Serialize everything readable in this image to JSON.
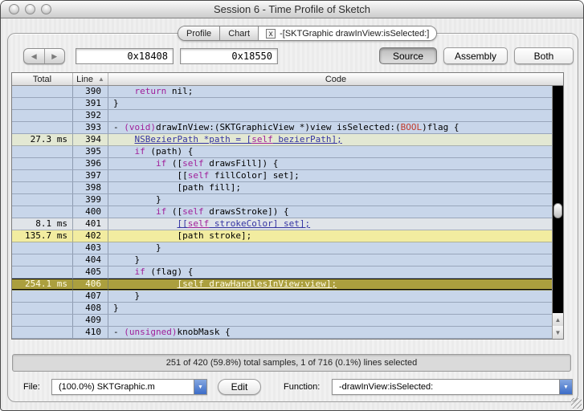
{
  "window": {
    "title": "Session 6 - Time Profile of Sketch"
  },
  "tabs": [
    {
      "label": "Profile"
    },
    {
      "label": "Chart"
    },
    {
      "label": "-[SKTGraphic drawInView:isSelected:]",
      "close": "x",
      "selected": true
    }
  ],
  "toolbar": {
    "back_icon": "◀",
    "forward_icon": "▶",
    "address_start": "0x18408",
    "address_end": "0x18550",
    "view_buttons": [
      {
        "label": "Source",
        "selected": true
      },
      {
        "label": "Assembly",
        "selected": false
      },
      {
        "label": "Both",
        "selected": false
      }
    ]
  },
  "table": {
    "columns": [
      "Total",
      "Line",
      "Code"
    ],
    "sort_column": "Line",
    "sort_direction": "asc",
    "sort_icon": "▲",
    "rows": [
      {
        "total": "",
        "line": "390",
        "bg": "blue",
        "code": [
          {
            "t": "    ",
            "c": "p"
          },
          {
            "t": "return",
            "c": "k"
          },
          {
            "t": " nil;",
            "c": "p"
          }
        ]
      },
      {
        "total": "",
        "line": "391",
        "bg": "blue",
        "code": [
          {
            "t": "}",
            "c": "p"
          }
        ]
      },
      {
        "total": "",
        "line": "392",
        "bg": "blue",
        "code": []
      },
      {
        "total": "",
        "line": "393",
        "bg": "blue",
        "code": [
          {
            "t": "- ",
            "c": "p"
          },
          {
            "t": "(void)",
            "c": "k"
          },
          {
            "t": "drawInView:(SKTGraphicView *)view isSelected:(",
            "c": "p"
          },
          {
            "t": "BOOL",
            "c": "r"
          },
          {
            "t": ")flag {",
            "c": "p"
          }
        ]
      },
      {
        "total": "27.3 ms",
        "line": "394",
        "bg": "green",
        "code": [
          {
            "t": "    ",
            "c": "p"
          },
          {
            "t": "NSBezierPath *path = [",
            "c": "l"
          },
          {
            "t": "self",
            "c": "lk"
          },
          {
            "t": " bezierPath];",
            "c": "l"
          }
        ]
      },
      {
        "total": "",
        "line": "395",
        "bg": "blue",
        "code": [
          {
            "t": "    ",
            "c": "p"
          },
          {
            "t": "if",
            "c": "k"
          },
          {
            "t": " (path) {",
            "c": "p"
          }
        ]
      },
      {
        "total": "",
        "line": "396",
        "bg": "blue",
        "code": [
          {
            "t": "        ",
            "c": "p"
          },
          {
            "t": "if",
            "c": "k"
          },
          {
            "t": " ([",
            "c": "p"
          },
          {
            "t": "self",
            "c": "k"
          },
          {
            "t": " drawsFill]) {",
            "c": "p"
          }
        ]
      },
      {
        "total": "",
        "line": "397",
        "bg": "blue",
        "code": [
          {
            "t": "            [[",
            "c": "p"
          },
          {
            "t": "self",
            "c": "k"
          },
          {
            "t": " fillColor] set];",
            "c": "p"
          }
        ]
      },
      {
        "total": "",
        "line": "398",
        "bg": "blue",
        "code": [
          {
            "t": "            [path fill];",
            "c": "p"
          }
        ]
      },
      {
        "total": "",
        "line": "399",
        "bg": "blue",
        "code": [
          {
            "t": "        }",
            "c": "p"
          }
        ]
      },
      {
        "total": "",
        "line": "400",
        "bg": "blue",
        "code": [
          {
            "t": "        ",
            "c": "p"
          },
          {
            "t": "if",
            "c": "k"
          },
          {
            "t": " ([",
            "c": "p"
          },
          {
            "t": "self",
            "c": "k"
          },
          {
            "t": " drawsStroke]) {",
            "c": "p"
          }
        ]
      },
      {
        "total": "8.1 ms",
        "line": "401",
        "bg": "gray",
        "code": [
          {
            "t": "            ",
            "c": "p"
          },
          {
            "t": "[[",
            "c": "l"
          },
          {
            "t": "self",
            "c": "lk"
          },
          {
            "t": " strokeColor] set];",
            "c": "l"
          }
        ]
      },
      {
        "total": "135.7 ms",
        "line": "402",
        "bg": "yellow",
        "code": [
          {
            "t": "            [path stroke];",
            "c": "p"
          }
        ]
      },
      {
        "total": "",
        "line": "403",
        "bg": "blue",
        "code": [
          {
            "t": "        }",
            "c": "p"
          }
        ]
      },
      {
        "total": "",
        "line": "404",
        "bg": "blue",
        "code": [
          {
            "t": "    }",
            "c": "p"
          }
        ]
      },
      {
        "total": "",
        "line": "405",
        "bg": "blue",
        "code": [
          {
            "t": "    ",
            "c": "p"
          },
          {
            "t": "if",
            "c": "k"
          },
          {
            "t": " (flag) {",
            "c": "p"
          }
        ]
      },
      {
        "total": "254.1 ms",
        "line": "406",
        "bg": "olive",
        "code": [
          {
            "t": "            ",
            "c": "p"
          },
          {
            "t": "[self drawHandlesInView:view];",
            "c": "sl"
          }
        ]
      },
      {
        "total": "",
        "line": "407",
        "bg": "blue",
        "code": [
          {
            "t": "    }",
            "c": "p"
          }
        ]
      },
      {
        "total": "",
        "line": "408",
        "bg": "blue",
        "code": [
          {
            "t": "}",
            "c": "p"
          }
        ]
      },
      {
        "total": "",
        "line": "409",
        "bg": "blue",
        "code": []
      },
      {
        "total": "",
        "line": "410",
        "bg": "blue",
        "code": [
          {
            "t": "- ",
            "c": "p"
          },
          {
            "t": "(unsigned)",
            "c": "k"
          },
          {
            "t": "knobMask {",
            "c": "p"
          }
        ]
      }
    ]
  },
  "scrollbar": {
    "up_icon": "▲",
    "down_icon": "▼"
  },
  "status_bar": {
    "text": "251 of 420 (59.8%) total samples, 1 of 716 (0.1%) lines selected"
  },
  "footer": {
    "file_label": "File:",
    "file_value": "(100.0%) SKTGraphic.m",
    "edit_label": "Edit",
    "function_label": "Function:",
    "function_value": "-drawInView:isSelected:",
    "popup_arrow": "▼"
  },
  "colors": {
    "row_default": "#c8d6ea",
    "row_low": "#e3e8d3",
    "row_verylow": "#e0e4e9",
    "row_medium": "#f2eca0",
    "row_selected": "#ab9f3e",
    "keyword": "#a0209a",
    "type_red": "#c0392b",
    "link": "#3434a2",
    "selected_text": "#fffbe6",
    "scroll_track": "#000000",
    "popup_accent": "#3c6cc8"
  }
}
